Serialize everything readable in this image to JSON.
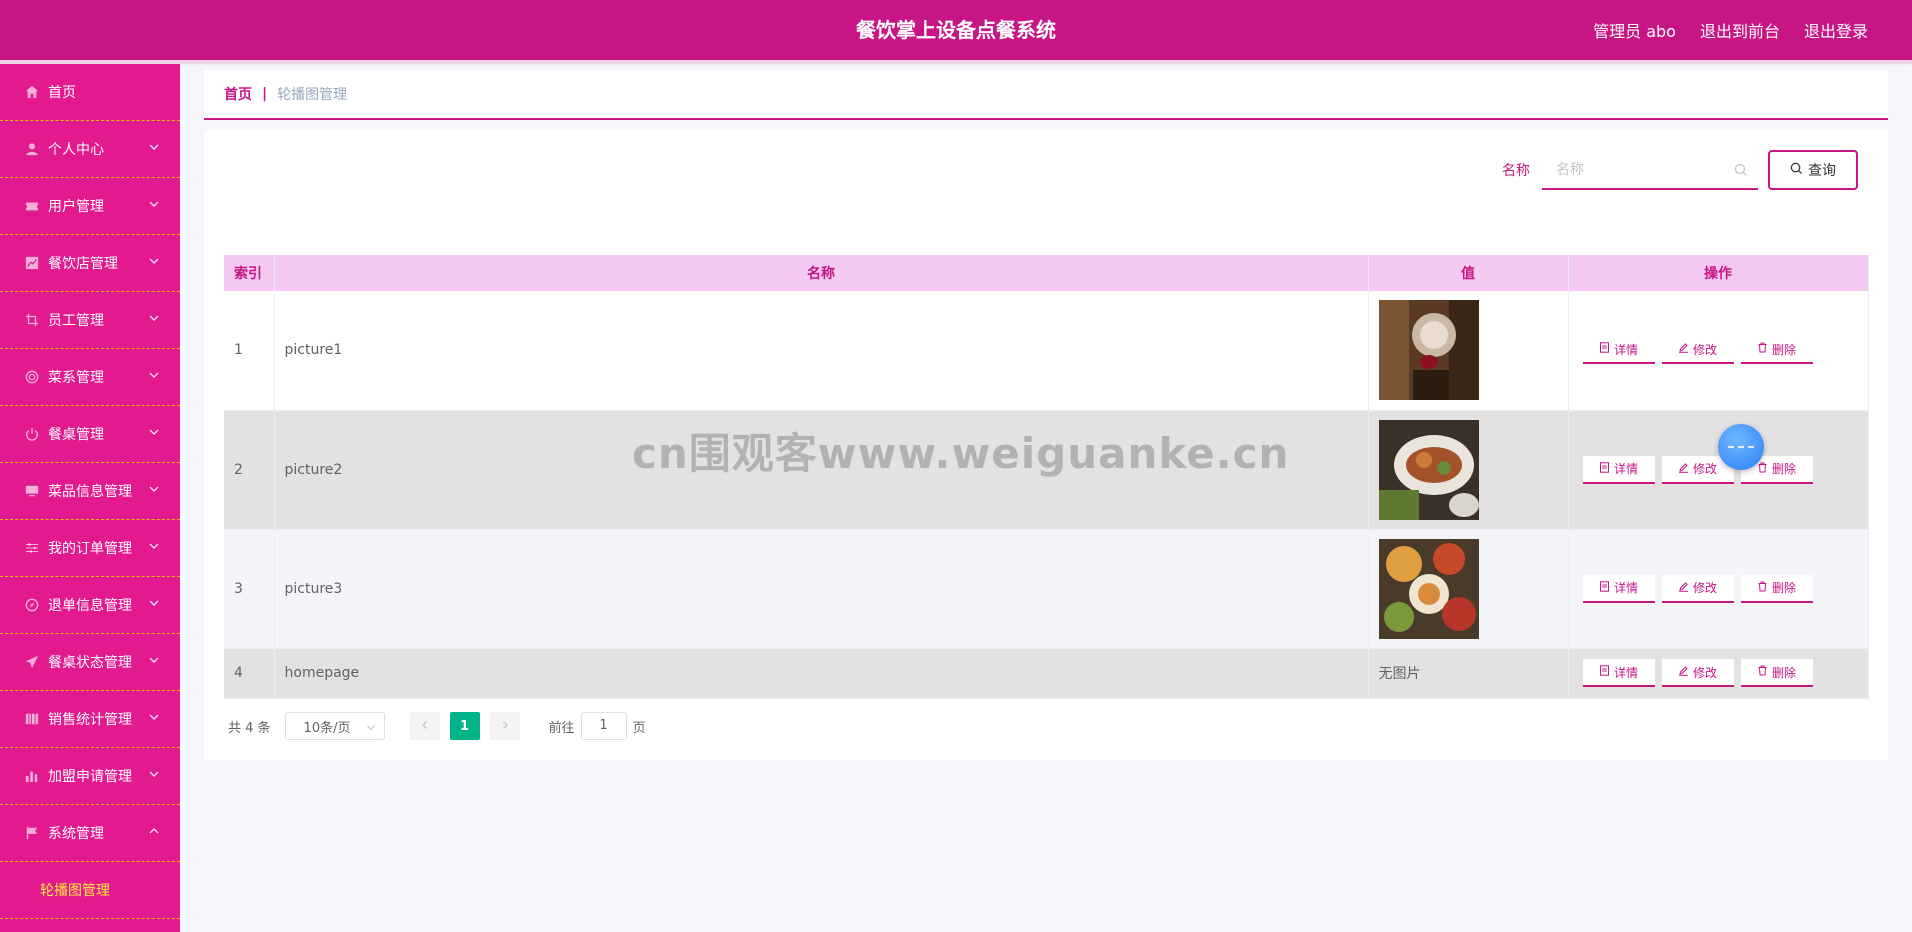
{
  "header": {
    "title": "餐饮掌上设备点餐系统",
    "admin": "管理员 abo",
    "to_front": "退出到前台",
    "logout": "退出登录"
  },
  "sidebar": {
    "items": [
      {
        "label": "首页",
        "icon": "home-icon"
      },
      {
        "label": "个人中心",
        "icon": "user-icon"
      },
      {
        "label": "用户管理",
        "icon": "ticket-icon"
      },
      {
        "label": "餐饮店管理",
        "icon": "chart-icon"
      },
      {
        "label": "员工管理",
        "icon": "crop-icon"
      },
      {
        "label": "菜系管理",
        "icon": "circle-icon"
      },
      {
        "label": "餐桌管理",
        "icon": "power-icon"
      },
      {
        "label": "菜品信息管理",
        "icon": "monitor-icon"
      },
      {
        "label": "我的订单管理",
        "icon": "sliders-icon"
      },
      {
        "label": "退单信息管理",
        "icon": "compass-icon"
      },
      {
        "label": "餐桌状态管理",
        "icon": "send-icon"
      },
      {
        "label": "销售统计管理",
        "icon": "bars-icon"
      },
      {
        "label": "加盟申请管理",
        "icon": "stats-icon"
      },
      {
        "label": "系统管理",
        "icon": "flag-icon"
      }
    ],
    "sub_item": "轮播图管理"
  },
  "breadcrumb": {
    "home": "首页",
    "sep": "|",
    "current": "轮播图管理"
  },
  "search": {
    "label": "名称",
    "placeholder": "名称",
    "button": "查询"
  },
  "table": {
    "headers": [
      "索引",
      "名称",
      "值",
      "操作"
    ],
    "rows": [
      {
        "index": "1",
        "name": "picture1",
        "value": ""
      },
      {
        "index": "2",
        "name": "picture2",
        "value": ""
      },
      {
        "index": "3",
        "name": "picture3",
        "value": ""
      },
      {
        "index": "4",
        "name": "homepage",
        "value": "无图片"
      }
    ],
    "actions": {
      "detail": "详情",
      "edit": "修改",
      "delete": "删除"
    }
  },
  "pagination": {
    "total": "共 4 条",
    "page_size": "10条/页",
    "current_page": "1",
    "goto_prefix": "前往",
    "goto_value": "1",
    "goto_suffix": "页"
  },
  "watermark": "cn围观客www.weiguanke.cn",
  "colors": {
    "brand": "#c71585",
    "sidebar": "#e3198f",
    "active_sub": "#ffeb3b",
    "page_active": "#00b388"
  }
}
